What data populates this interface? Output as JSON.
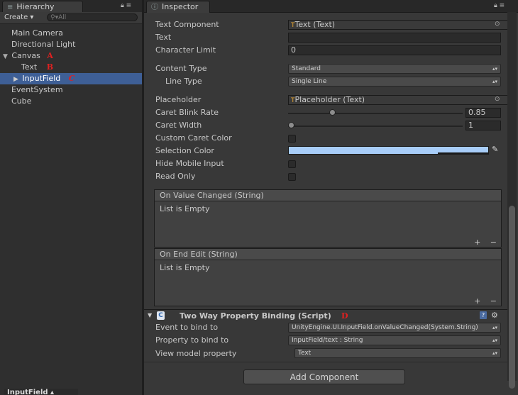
{
  "hierarchy": {
    "tab_label": "Hierarchy",
    "create_label": "Create",
    "search_placeholder": "All",
    "items": [
      {
        "label": "Main Camera"
      },
      {
        "label": "Directional Light"
      },
      {
        "label": "Canvas",
        "annotation": "A"
      },
      {
        "label": "Text",
        "annotation": "B"
      },
      {
        "label": "InputField",
        "annotation": "C"
      },
      {
        "label": "EventSystem"
      },
      {
        "label": "Cube"
      }
    ]
  },
  "inspector": {
    "tab_label": "Inspector",
    "text_component": {
      "label": "Text Component",
      "value": "Text (Text)"
    },
    "text": {
      "label": "Text",
      "value": ""
    },
    "character_limit": {
      "label": "Character Limit",
      "value": "0"
    },
    "content_type": {
      "label": "Content Type",
      "value": "Standard"
    },
    "line_type": {
      "label": "Line Type",
      "value": "Single Line"
    },
    "placeholder": {
      "label": "Placeholder",
      "value": "Placeholder (Text)"
    },
    "caret_blink_rate": {
      "label": "Caret Blink Rate",
      "value": "0.85",
      "fraction": 0.25
    },
    "caret_width": {
      "label": "Caret Width",
      "value": "1",
      "fraction": 0.0
    },
    "custom_caret_color": {
      "label": "Custom Caret Color",
      "checked": false
    },
    "selection_color": {
      "label": "Selection Color",
      "color": "#a8cdf8"
    },
    "hide_mobile_input": {
      "label": "Hide Mobile Input",
      "checked": false
    },
    "read_only": {
      "label": "Read Only",
      "checked": false
    },
    "events": [
      {
        "title": "On Value Changed (String)",
        "body": "List is Empty",
        "add": "+",
        "remove": "−"
      },
      {
        "title": "On End Edit (String)",
        "body": "List is Empty",
        "add": "+",
        "remove": "−"
      }
    ],
    "binding": {
      "title": "Two Way Property Binding (Script)",
      "annotation": "D",
      "event_label": "Event to bind to",
      "event_value": "UnityEngine.UI.InputField.onValueChanged(System.String)",
      "property_label": "Property to bind to",
      "property_value": "InputField/text : String",
      "viewmodel_label": "View model property",
      "viewmodel_value": "Text"
    },
    "add_component": "Add Component"
  },
  "bottom_tab": "InputField",
  "colors": {
    "selection": "#3e5f96",
    "annotation": "#e02020",
    "selection_color": "#a8cdf8"
  }
}
